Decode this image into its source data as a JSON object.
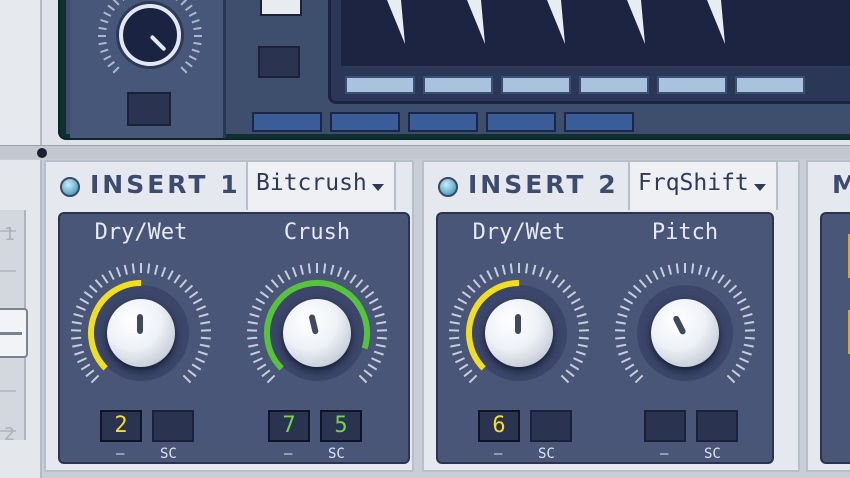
{
  "top_device": {
    "wave_color": "#e8ecf3",
    "screen_color": "#1c2442",
    "step_light_count": 6,
    "step_dark_count": 5
  },
  "left_fader": {
    "numbers": [
      "1",
      "2"
    ]
  },
  "inserts": [
    {
      "title": "INSERT 1",
      "effect": "Bitcrush",
      "led_color": "#6fb6d6",
      "knobs": [
        {
          "label": "Dry/Wet",
          "value": 0.5,
          "ring_color": "#f1df1f",
          "mod_amount": 0
        },
        {
          "label": "Crush",
          "value": 0.45,
          "ring_color": "#56c43a",
          "mod_amount": 1
        }
      ],
      "slots": [
        {
          "value": "2",
          "color": "yellow"
        },
        {
          "value": "",
          "color": ""
        },
        {
          "value": "7",
          "color": "green"
        },
        {
          "value": "5",
          "color": "green"
        }
      ],
      "captions": [
        "–",
        "SC",
        "–",
        "SC"
      ]
    },
    {
      "title": "INSERT 2",
      "effect": "FrqShift",
      "led_color": "#6fb6d6",
      "knobs": [
        {
          "label": "Dry/Wet",
          "value": 0.5,
          "ring_color": "#f1df1f",
          "mod_amount": 0
        },
        {
          "label": "Pitch",
          "value": 0.4,
          "ring_color": "",
          "mod_amount": 0
        }
      ],
      "slots": [
        {
          "value": "6",
          "color": "yellow"
        },
        {
          "value": "",
          "color": ""
        },
        {
          "value": "",
          "color": ""
        },
        {
          "value": "",
          "color": ""
        }
      ],
      "captions": [
        "–",
        "SC",
        "–",
        "SC"
      ]
    }
  ],
  "insert_3_partial": {
    "title": "M"
  },
  "colors": {
    "panel_bg": "#4a5678",
    "chrome": "#e5e8ee",
    "title_text": "#3d4b6e",
    "yellow": "#f1df1f",
    "green": "#56c43a"
  }
}
